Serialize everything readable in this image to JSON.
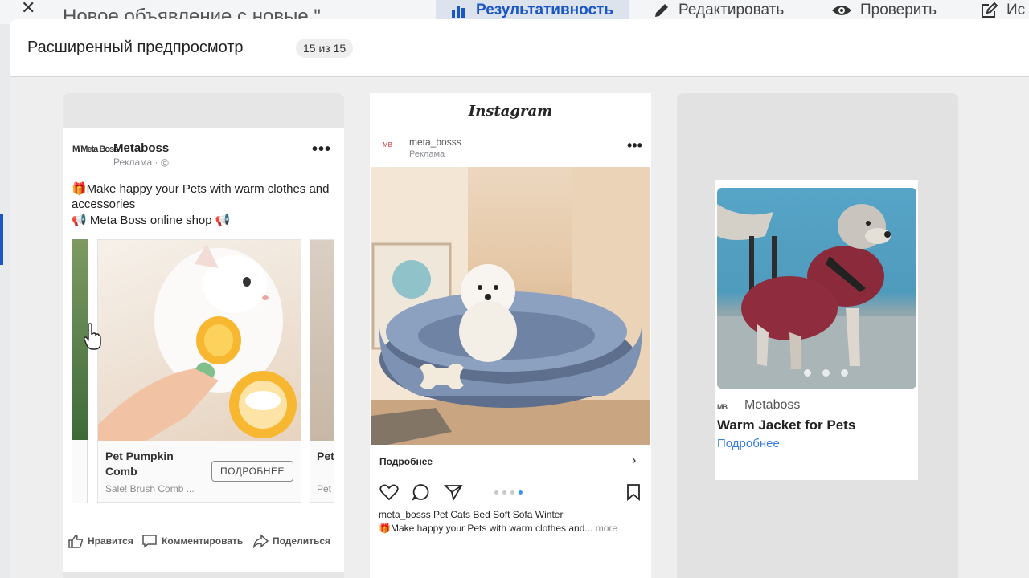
{
  "background": {
    "title": "Новое объявление с новые \"",
    "tabs": [
      {
        "label": "Результативность",
        "active": true
      },
      {
        "label": "Редактировать",
        "active": false
      },
      {
        "label": "Проверить",
        "active": false
      },
      {
        "label": "Ис",
        "active": false
      }
    ]
  },
  "modal": {
    "title": "Расширенный предпросмотр",
    "counter": "15 из 15"
  },
  "facebook": {
    "logo_text": "M̸ Meta Boss",
    "page_name": "Metaboss",
    "sponsored": "Реклама · ◎",
    "text_line1": "🎁Make happy your Pets with warm clothes and accessories",
    "text_line2": "📢 Meta Boss online shop 📢",
    "slide": {
      "title": "Pet Pumpkin Comb",
      "subtitle": "Sale! Brush Comb ...",
      "button": "ПОДРОБНЕЕ"
    },
    "slide_next": {
      "title": "Pet Sof",
      "subtitle": "Pet"
    },
    "actions": {
      "like": "Нравится",
      "comment": "Комментировать",
      "share": "Поделиться"
    }
  },
  "instagram": {
    "logo": "Instagram",
    "avatar_text": "MB",
    "username": "meta_bosss",
    "sponsored": "Реклама",
    "cta": "Подробнее",
    "caption_line1": "meta_bosss Pet Cats Bed Soft Sofa Winter",
    "caption_line2": "🎁Make happy your Pets with warm clothes and...",
    "caption_more": "more",
    "carousel_dots": 4,
    "active_dot": 3
  },
  "right_preview": {
    "logo_text": "MB",
    "brand": "Metaboss",
    "title": "Warm Jacket for Pets",
    "link": "Подробнее",
    "carousel_dots": 3
  },
  "colors": {
    "accent_blue": "#1a56c4",
    "link_blue": "#3b7fd5",
    "ig_active_dot": "#3897f0"
  }
}
